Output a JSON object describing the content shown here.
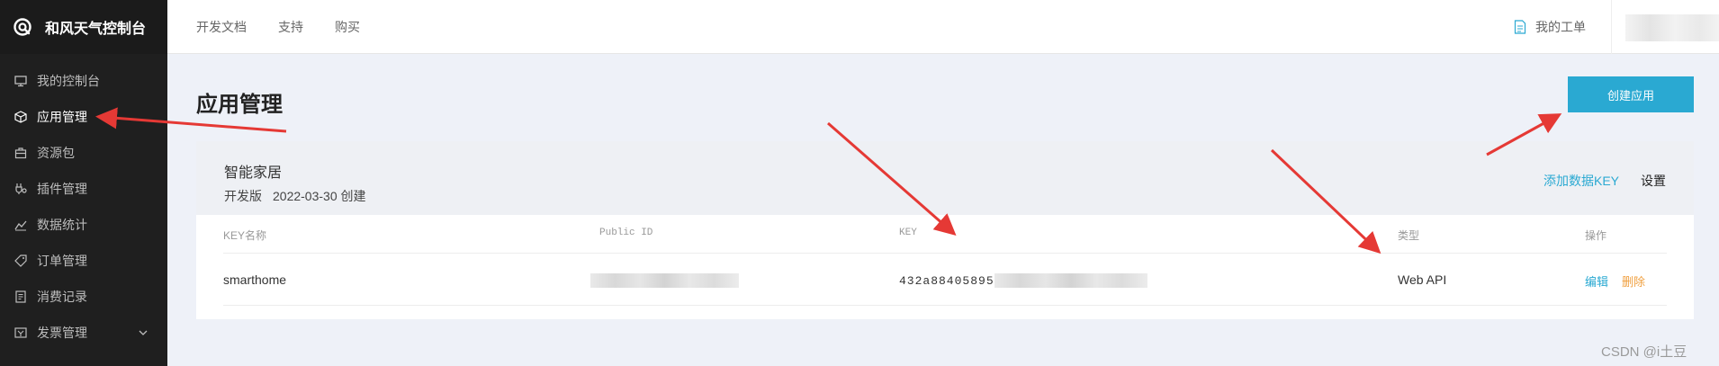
{
  "brand": {
    "name": "和风天气控制台"
  },
  "sidebar": {
    "items": [
      {
        "label": "我的控制台",
        "icon": "monitor-icon"
      },
      {
        "label": "应用管理",
        "icon": "cube-icon",
        "active": true
      },
      {
        "label": "资源包",
        "icon": "package-icon"
      },
      {
        "label": "插件管理",
        "icon": "plugin-icon"
      },
      {
        "label": "数据统计",
        "icon": "chart-icon"
      },
      {
        "label": "订单管理",
        "icon": "tag-icon"
      },
      {
        "label": "消费记录",
        "icon": "receipt-icon"
      },
      {
        "label": "发票管理",
        "icon": "invoice-icon",
        "expandable": true
      }
    ]
  },
  "topbar": {
    "links": [
      "开发文档",
      "支持",
      "购买"
    ],
    "work_order": "我的工单"
  },
  "page": {
    "title": "应用管理",
    "create_button": "创建应用"
  },
  "app": {
    "name": "智能家居",
    "edition": "开发版",
    "created": "2022-03-30 创建",
    "add_key": "添加数据KEY",
    "settings": "设置"
  },
  "table": {
    "headers": {
      "key_name": "KEY名称",
      "public_id": "Public ID",
      "key": "KEY",
      "type": "类型",
      "actions": "操作"
    },
    "rows": [
      {
        "key_name": "smarthome",
        "public_id": "",
        "key_prefix": "432a88405895",
        "type": "Web API",
        "edit": "编辑",
        "delete": "删除"
      }
    ]
  },
  "annotations": {
    "arrow_color": "#e53935"
  },
  "watermark": "CSDN @i土豆",
  "colors": {
    "accent": "#2aa9d2",
    "sidebar_bg": "#1f1f1f",
    "delete": "#f0a040"
  }
}
